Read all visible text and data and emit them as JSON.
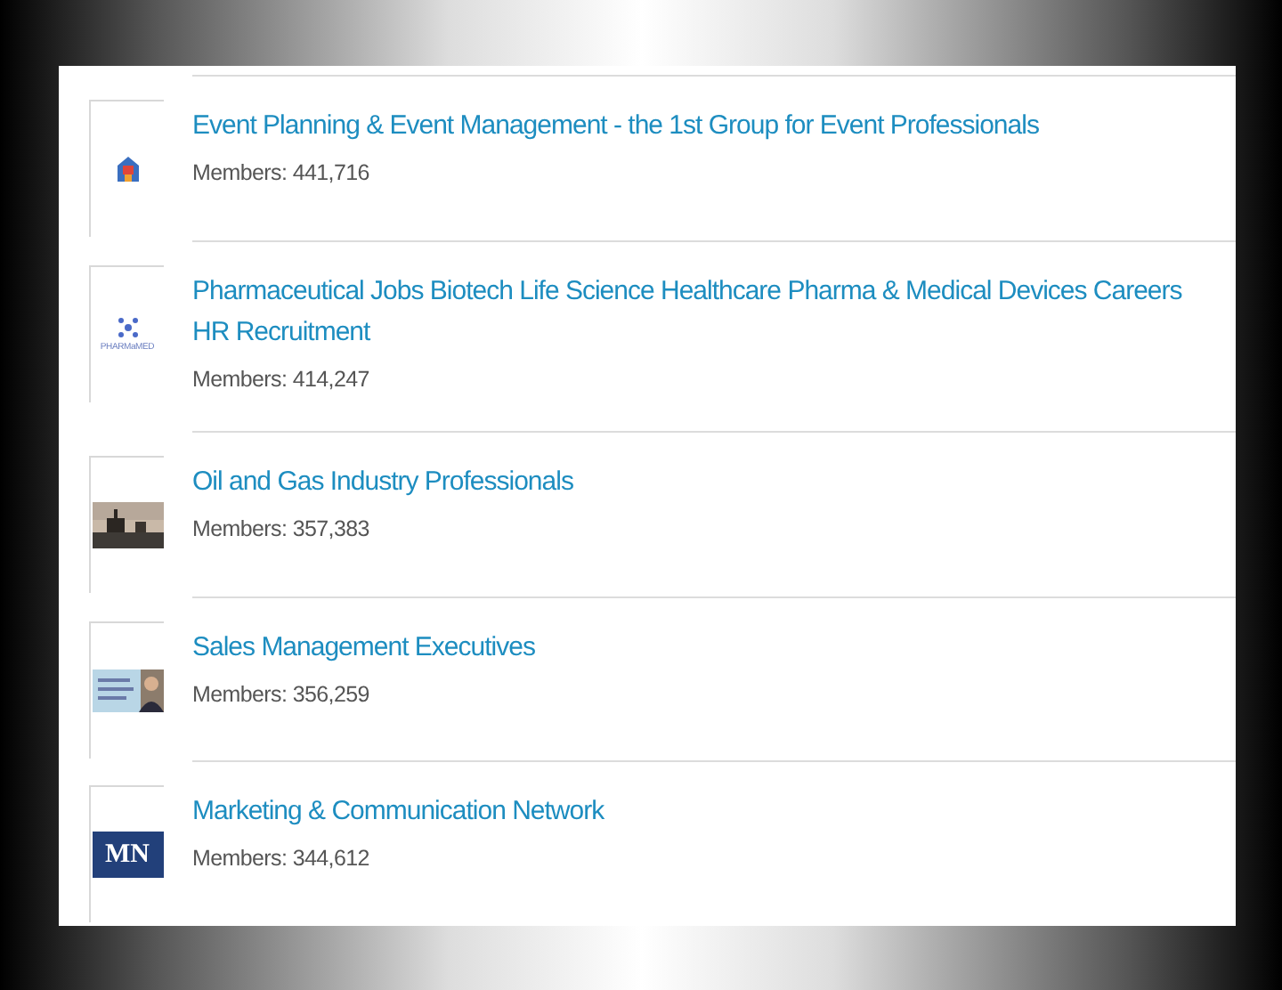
{
  "groups": [
    {
      "title": "Event Planning & Event Management - the 1st Group for Event Professionals",
      "members": "Members: 441,716",
      "logo": {
        "kind": "event"
      }
    },
    {
      "title": "Pharmaceutical Jobs Biotech Life Science Healthcare Pharma & Medical Devices Careers HR Recruitment",
      "members": "Members: 414,247",
      "logo": {
        "kind": "pharma",
        "text": "PHARMaMED"
      }
    },
    {
      "title": "Oil and Gas Industry Professionals",
      "members": "Members: 357,383"
    },
    {
      "title": "Sales Management Executives",
      "members": "Members: 356,259",
      "logo": {
        "kind": "portrait"
      }
    },
    {
      "title": "Marketing & Communication Network",
      "members": "Members: 344,612",
      "logo": {
        "kind": "monogram",
        "text": "MN"
      }
    }
  ]
}
